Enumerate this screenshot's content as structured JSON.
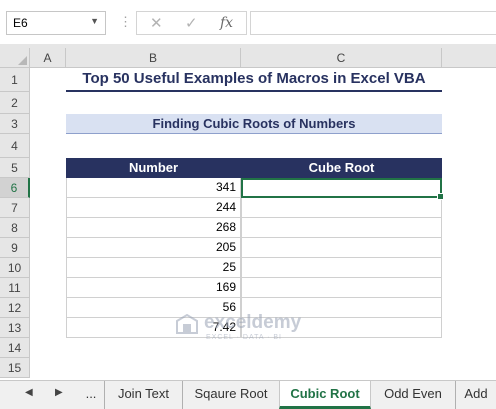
{
  "formula_bar": {
    "name_box": "E6",
    "separator_glyph": "⋮",
    "cancel_icon": "✕",
    "enter_icon": "✓",
    "fx_label": "fx",
    "formula": ""
  },
  "columns": [
    "A",
    "B",
    "C"
  ],
  "rows": [
    "1",
    "2",
    "3",
    "4",
    "5",
    "6",
    "7",
    "8",
    "9",
    "10",
    "11",
    "12",
    "13",
    "14",
    "15"
  ],
  "selected_row": "6",
  "sheet": {
    "title": "Top 50 Useful Examples of Macros in Excel VBA",
    "subtitle": "Finding Cubic Roots of Numbers",
    "table": {
      "headers": [
        "Number",
        "Cube Root"
      ],
      "numbers": [
        "341",
        "244",
        "268",
        "205",
        "25",
        "169",
        "56",
        "7.42"
      ]
    }
  },
  "watermark": {
    "name": "exceldemy",
    "tagline": "EXCEL · DATA · BI"
  },
  "tabs": {
    "prev_icon": "◀",
    "next_icon": "▶",
    "more_label": "...",
    "items": [
      "Join Text",
      "Sqaure Root",
      "Cubic Root",
      "Odd Even",
      "Add"
    ],
    "active": "Cubic Root"
  },
  "colors": {
    "accent": "#217346",
    "header_navy": "#283260",
    "subtitle_fill": "#d9e1f2"
  }
}
